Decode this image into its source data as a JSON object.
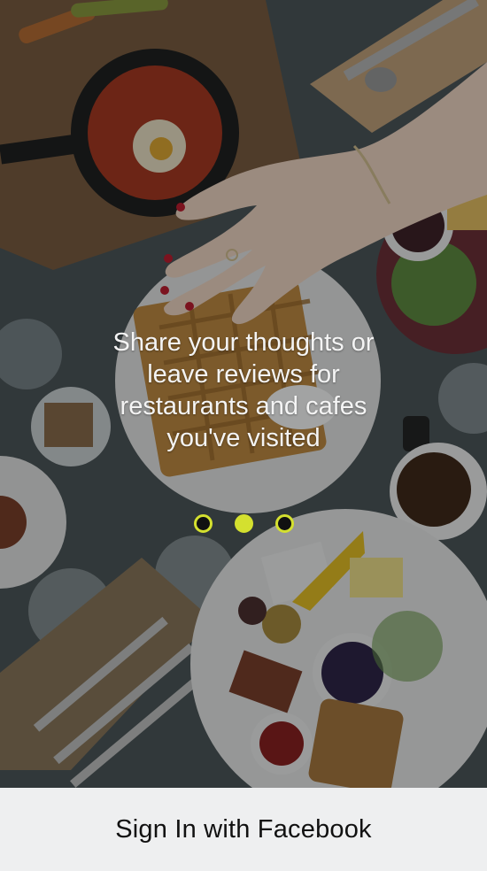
{
  "onboarding": {
    "message": "Share your thoughts or\nleave reviews for\nrestaurants and cafes\nyou've visited"
  },
  "pager": {
    "total": 3,
    "active_index": 1
  },
  "signin": {
    "facebook_label": "Sign In with Facebook"
  },
  "colors": {
    "accent": "#d4e02f",
    "bar_background": "#eeeff0"
  },
  "icons": {
    "background": "food-table-photo"
  }
}
